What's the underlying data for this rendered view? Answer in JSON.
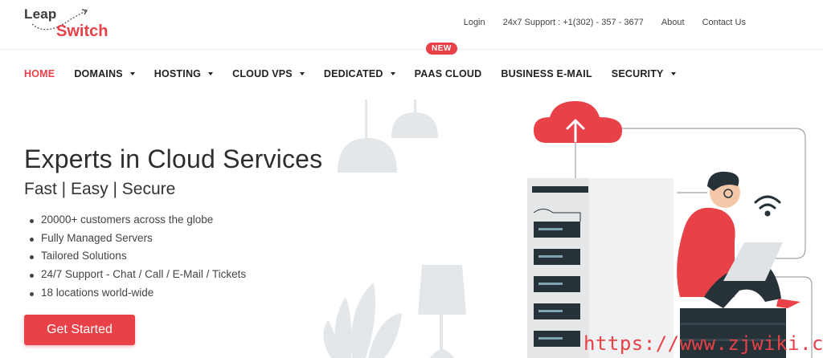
{
  "brand": {
    "logo_top": "Leap",
    "logo_bottom": "Switch"
  },
  "toplinks": {
    "login": "Login",
    "support": "24x7 Support : +1(302) - 357 - 3677",
    "about": "About",
    "contact": "Contact Us"
  },
  "nav": {
    "home": "HOME",
    "domains": "DOMAINS",
    "hosting": "HOSTING",
    "cloud_vps": "CLOUD VPS",
    "dedicated": "DEDICATED",
    "paas_cloud": "PAAS CLOUD",
    "paas_badge": "NEW",
    "business_email": "BUSINESS E-MAIL",
    "security": "SECURITY"
  },
  "hero": {
    "title": "Experts in Cloud Services",
    "subtitle": "Fast | Easy | Secure",
    "features": [
      "20000+ customers across the globe",
      "Fully Managed Servers",
      "Tailored Solutions",
      "24/7 Support - Chat / Call / E-Mail / Tickets",
      "18 locations world-wide"
    ],
    "cta": "Get Started"
  },
  "watermark": "https://www.zjwiki.com",
  "colors": {
    "accent": "#e84148",
    "text": "#2e2e2e"
  }
}
